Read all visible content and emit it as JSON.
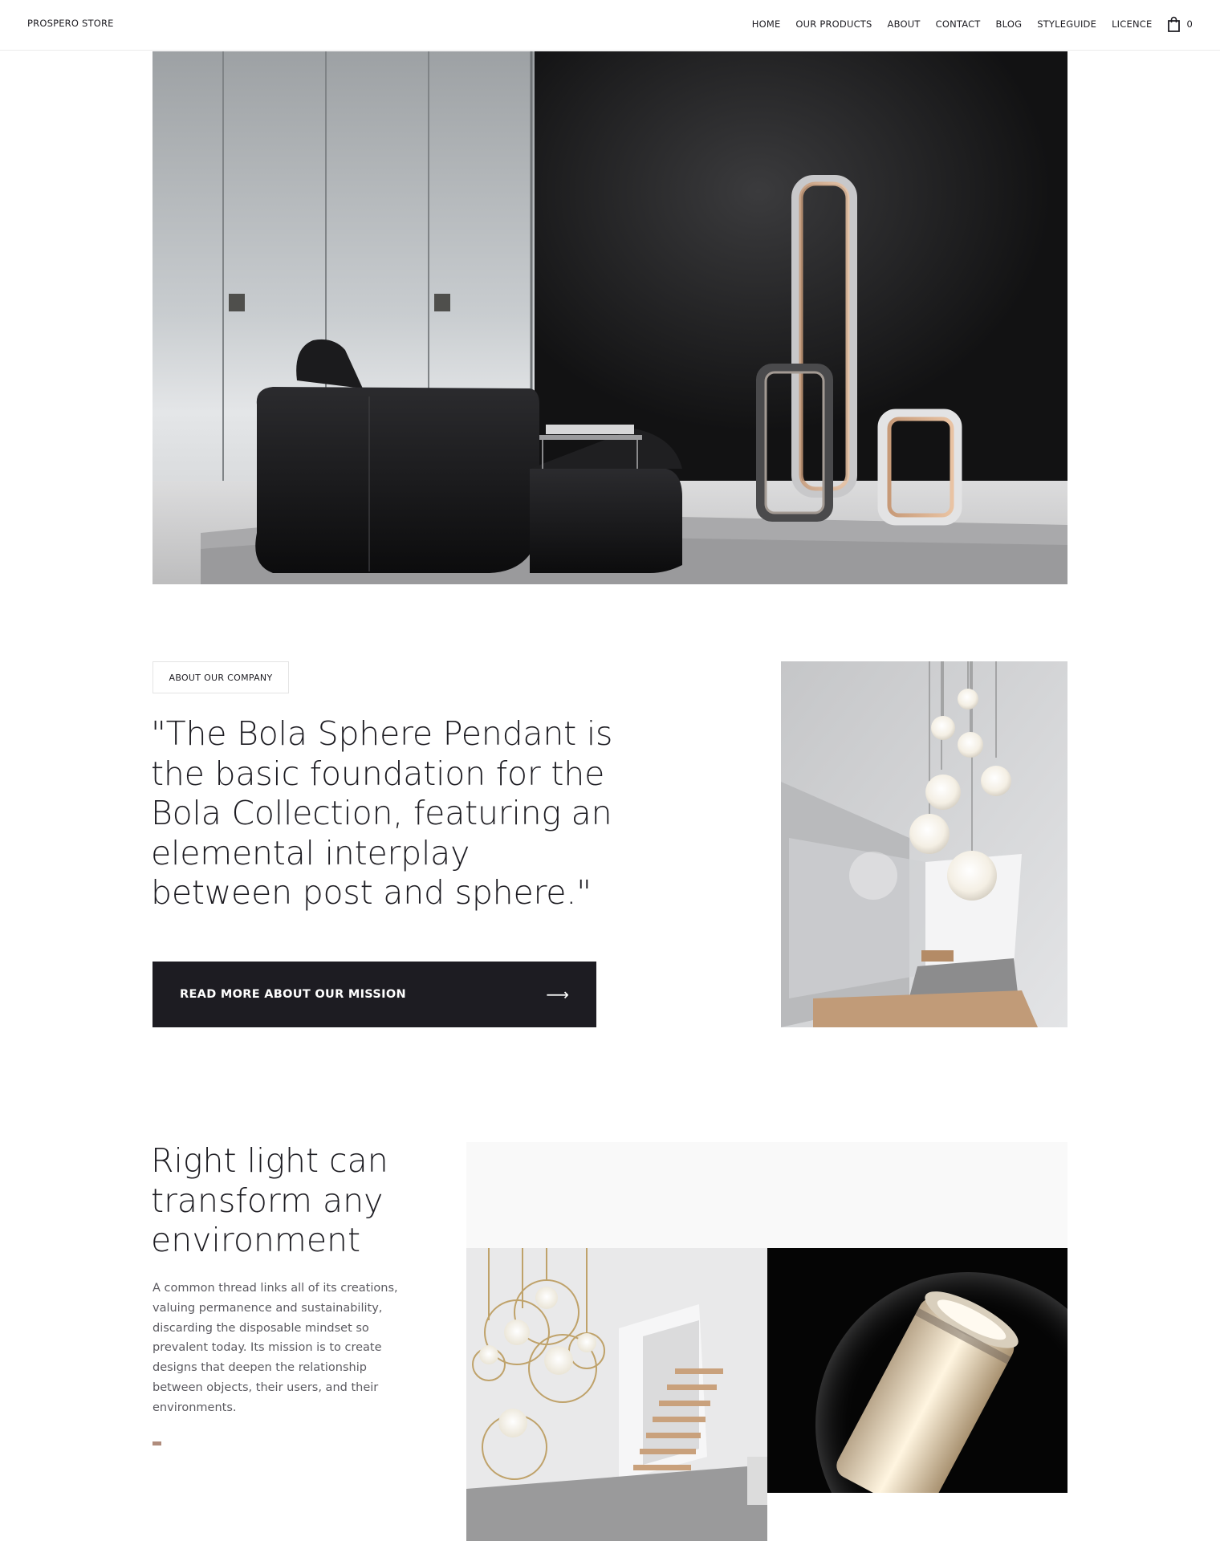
{
  "header": {
    "brand": "PROSPERO STORE",
    "nav": [
      "HOME",
      "OUR PRODUCTS",
      "ABOUT",
      "CONTACT",
      "BLOG",
      "STYLEGUIDE",
      "LICENCE"
    ],
    "cart_count": "0",
    "cart_icon": "shopping-bag-icon"
  },
  "about": {
    "badge": "ABOUT OUR COMPANY",
    "quote": "\"The Bola Sphere Pendant is the basic foundation for the Bola Collection, featuring an elemental interplay between post and sphere.\"",
    "cta_label": "READ MORE ABOUT OUR MISSION",
    "cta_arrow": "⟶"
  },
  "light": {
    "heading": "Right light can transform any environment",
    "text": "A common thread links all of its creations, valuing permanence and sustainability, discarding the disposable mindset so prevalent today. Its mission is to create designs that deepen the relationship between objects, their users, and their environments."
  },
  "colors": {
    "dark": "#1d1c22",
    "accent": "#b08c7c",
    "panel": "#f9f9f9",
    "body_text": "#5b5a60"
  }
}
